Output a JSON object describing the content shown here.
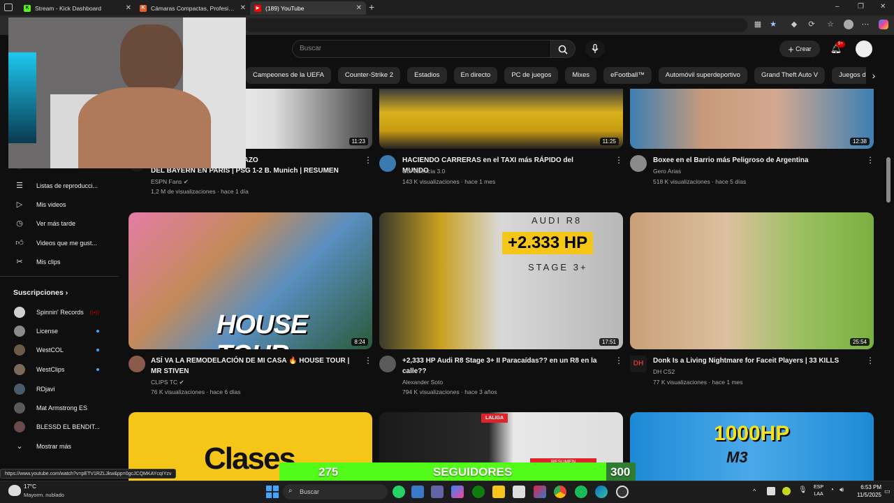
{
  "browser": {
    "tabs": [
      {
        "title": "Stream - Kick Dashboard",
        "favicon_color": "#53fc18",
        "favicon_letter": "K",
        "active": false
      },
      {
        "title": "Cámaras Compactas, Profesionale",
        "favicon_color": "#e85d2a",
        "favicon_letter": "K",
        "active": false
      },
      {
        "title": "(189) YouTube",
        "favicon_color": "#ff0000",
        "favicon_letter": "▶",
        "active": true
      }
    ],
    "new_tab": "+",
    "window_controls": [
      "–",
      "❐",
      "✕"
    ]
  },
  "youtube": {
    "search_placeholder": "Buscar",
    "create_label": "Crear",
    "notifications_badge": "9+",
    "chips": [
      "Campeones de la UEFA",
      "Counter-Strike 2",
      "Estadios",
      "En directo",
      "PC de juegos",
      "Mixes",
      "eFootball™",
      "Automóvil superdeportivo",
      "Grand Theft Auto V",
      "Juegos de acción y aven"
    ],
    "sidebar": {
      "items": [
        {
          "label": "Listas de reproducci...",
          "icon": "playlist-icon"
        },
        {
          "label": "Mis videos",
          "icon": "my-videos-icon"
        },
        {
          "label": "Ver más tarde",
          "icon": "clock-icon"
        },
        {
          "label": "Videos que me gust...",
          "icon": "thumbs-up-icon"
        },
        {
          "label": "Mis clips",
          "icon": "scissors-icon"
        }
      ],
      "subscriptions_heading": "Suscripciones",
      "subscriptions": [
        {
          "label": "Spinnin' Records",
          "live": true,
          "color": "#d0d0d0"
        },
        {
          "label": "License",
          "dot": true,
          "color": "#8a8a8a"
        },
        {
          "label": "WestCOL",
          "dot": true,
          "color": "#6b5a4a"
        },
        {
          "label": "WestClips",
          "dot": true,
          "color": "#7a6a5a"
        },
        {
          "label": "RDjavi",
          "dot": false,
          "color": "#4a5a6a"
        },
        {
          "label": "Mat Armstrong ES",
          "dot": false,
          "color": "#5a5a5a"
        },
        {
          "label": "BLESSD EL BENDIT...",
          "dot": false,
          "color": "#6a4a4a"
        }
      ],
      "show_more": "Mostrar más"
    },
    "videos_row1": [
      {
        "title_line1": "LUCHO DÍAZ EN EL TRIUNFAZO",
        "title_line2": "DEL BAYERN EN PARÍS | PSG 1-2 B. Munich | RESUMEN",
        "channel": "ESPN Fans",
        "verified": true,
        "meta": "1,2 M de visualizaciones · hace 1 día",
        "duration": "11:23"
      },
      {
        "title_line1": "HACIENDO CARRERAS en el TAXI más RÁPIDO del MUNDO",
        "title_line2": "",
        "channel": "Col Valencia 3.0",
        "verified": false,
        "meta": "143 K visualizaciones · hace 1 mes",
        "duration": "11:25"
      },
      {
        "title_line1": "Boxee en el Barrio más Peligroso de Argentina",
        "title_line2": "",
        "channel": "Gero Arias",
        "verified": false,
        "meta": "518 K visualizaciones · hace 5 días",
        "duration": "12:38"
      }
    ],
    "videos_row2": [
      {
        "title_line1": "ASÍ VA LA REMODELACIÓN DE MI CASA 🔥 HOUSE TOUR |",
        "title_line2": "MR STIVEN",
        "channel": "CLIPS TC",
        "verified": true,
        "meta": "76 K visualizaciones · hace 6 días",
        "duration": "8:24",
        "thumb_text": "HOUSE TOUR"
      },
      {
        "title_line1": "+2,333 HP Audi R8 Stage 3+ II Paracaídas?? en un R8 en la",
        "title_line2": "calle??",
        "channel": "Alexander Soto",
        "verified": false,
        "meta": "794 K visualizaciones · hace 3 años",
        "duration": "17:51",
        "thumb_text_top": "AUDI R8",
        "thumb_text_mid": "+2.333 HP",
        "thumb_text_bottom": "STAGE 3+"
      },
      {
        "title_line1": "Donk Is a Living Nightmare for Faceit Players | 33 KILLS",
        "title_line2": "",
        "channel": "DH CS2",
        "verified": false,
        "meta": "77 K visualizaciones · hace 1 mes",
        "duration": "25:54",
        "channel_badge": "DH"
      }
    ],
    "videos_row3": [
      {
        "thumb_text": "Clases"
      },
      {
        "thumb_text": "RESUMEN",
        "thumb_brand": "LALIGA"
      },
      {
        "thumb_text_top": "1000HP",
        "thumb_text_bottom": "M3"
      }
    ]
  },
  "overlay": {
    "followers_current": "275",
    "followers_label": "SEGUIDORES",
    "followers_goal": "300",
    "progress_fraction": 0.917
  },
  "status_url": "https://www.youtube.com/watch?v=pETV1RZLJkw&pp=0gcJCQMKAYcqIYzv",
  "taskbar": {
    "weather_temp": "17°C",
    "weather_desc": "Mayorm. nublado",
    "search_placeholder": "Buscar",
    "lang_line1": "ESP",
    "lang_line2": "LAA",
    "time": "6:53 PM",
    "date": "11/5/2025"
  }
}
